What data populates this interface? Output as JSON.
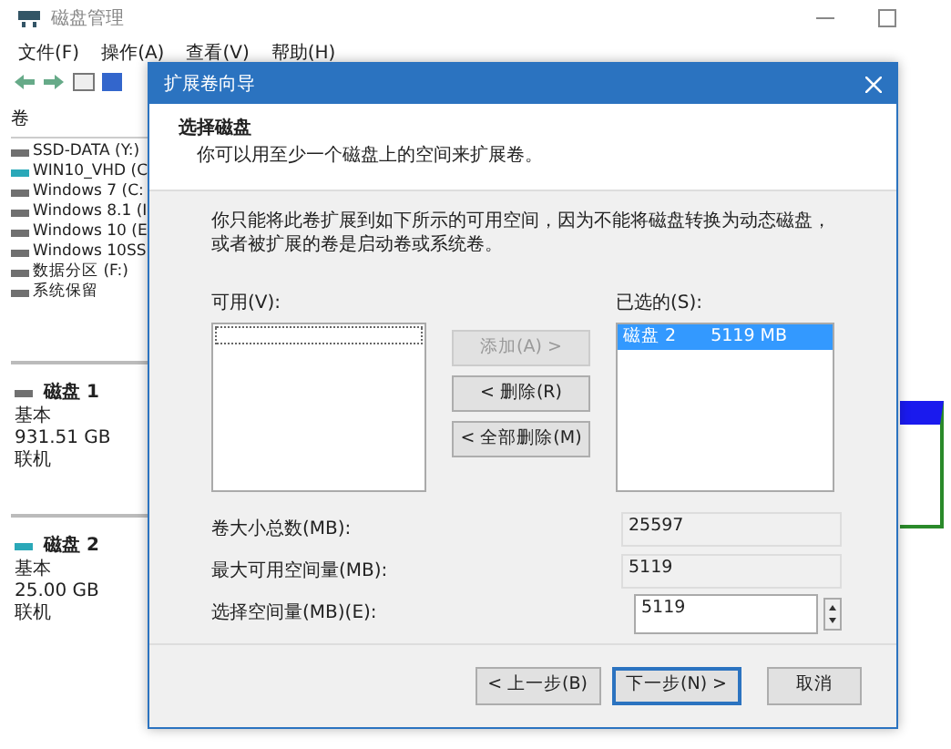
{
  "window": {
    "title": "磁盘管理",
    "menu": [
      "文件(F)",
      "操作(A)",
      "查看(V)",
      "帮助(H)"
    ]
  },
  "volume_list": {
    "header": "卷",
    "items": [
      {
        "name": "SSD-DATA (Y:)",
        "color": "#707070"
      },
      {
        "name": "WIN10_VHD (C",
        "color": "#2aa8b8"
      },
      {
        "name": "Windows 7 (C:",
        "color": "#707070"
      },
      {
        "name": "Windows 8.1 (I",
        "color": "#707070"
      },
      {
        "name": "Windows 10 (E",
        "color": "#707070"
      },
      {
        "name": "Windows 10SS",
        "color": "#707070"
      },
      {
        "name": "数据分区 (F:)",
        "color": "#707070"
      },
      {
        "name": "系统保留",
        "color": "#707070"
      }
    ]
  },
  "disks": [
    {
      "name": "磁盘 1",
      "type": "基本",
      "size": "931.51 GB",
      "status": "联机",
      "color": "#707070"
    },
    {
      "name": "磁盘 2",
      "type": "基本",
      "size": "25.00 GB",
      "status": "联机",
      "color": "#2aa8b8"
    }
  ],
  "dialog": {
    "title": "扩展卷向导",
    "heading": "选择磁盘",
    "subheading": "你可以用至少一个磁盘上的空间来扩展卷。",
    "description": "你只能将此卷扩展到如下所示的可用空间，因为不能将磁盘转换为动态磁盘，或者被扩展的卷是启动卷或系统卷。",
    "available_label": "可用(V):",
    "buttons": [
      {
        "label": "添加(A) >",
        "disabled": true
      },
      {
        "label": "< 删除(R)",
        "disabled": false
      },
      {
        "label": "< 全部删除(M)",
        "disabled": false
      }
    ],
    "selected_label": "已选的(S):",
    "selected_items": [
      {
        "disk": "磁盘 2",
        "size": "5119 MB",
        "selected": true
      }
    ],
    "fields": [
      {
        "label": "卷大小总数(MB):",
        "value": "25597",
        "kind": "readonly"
      },
      {
        "label": "最大可用空间量(MB):",
        "value": "5119",
        "kind": "readonly"
      },
      {
        "label": "选择空间量(MB)(E):",
        "value": "5119",
        "kind": "spin"
      }
    ],
    "footer_buttons": [
      {
        "label": "< 上一步(B)",
        "focused": false
      },
      {
        "label": "下一步(N) >",
        "focused": true
      },
      {
        "label": "取消",
        "focused": false
      }
    ]
  }
}
